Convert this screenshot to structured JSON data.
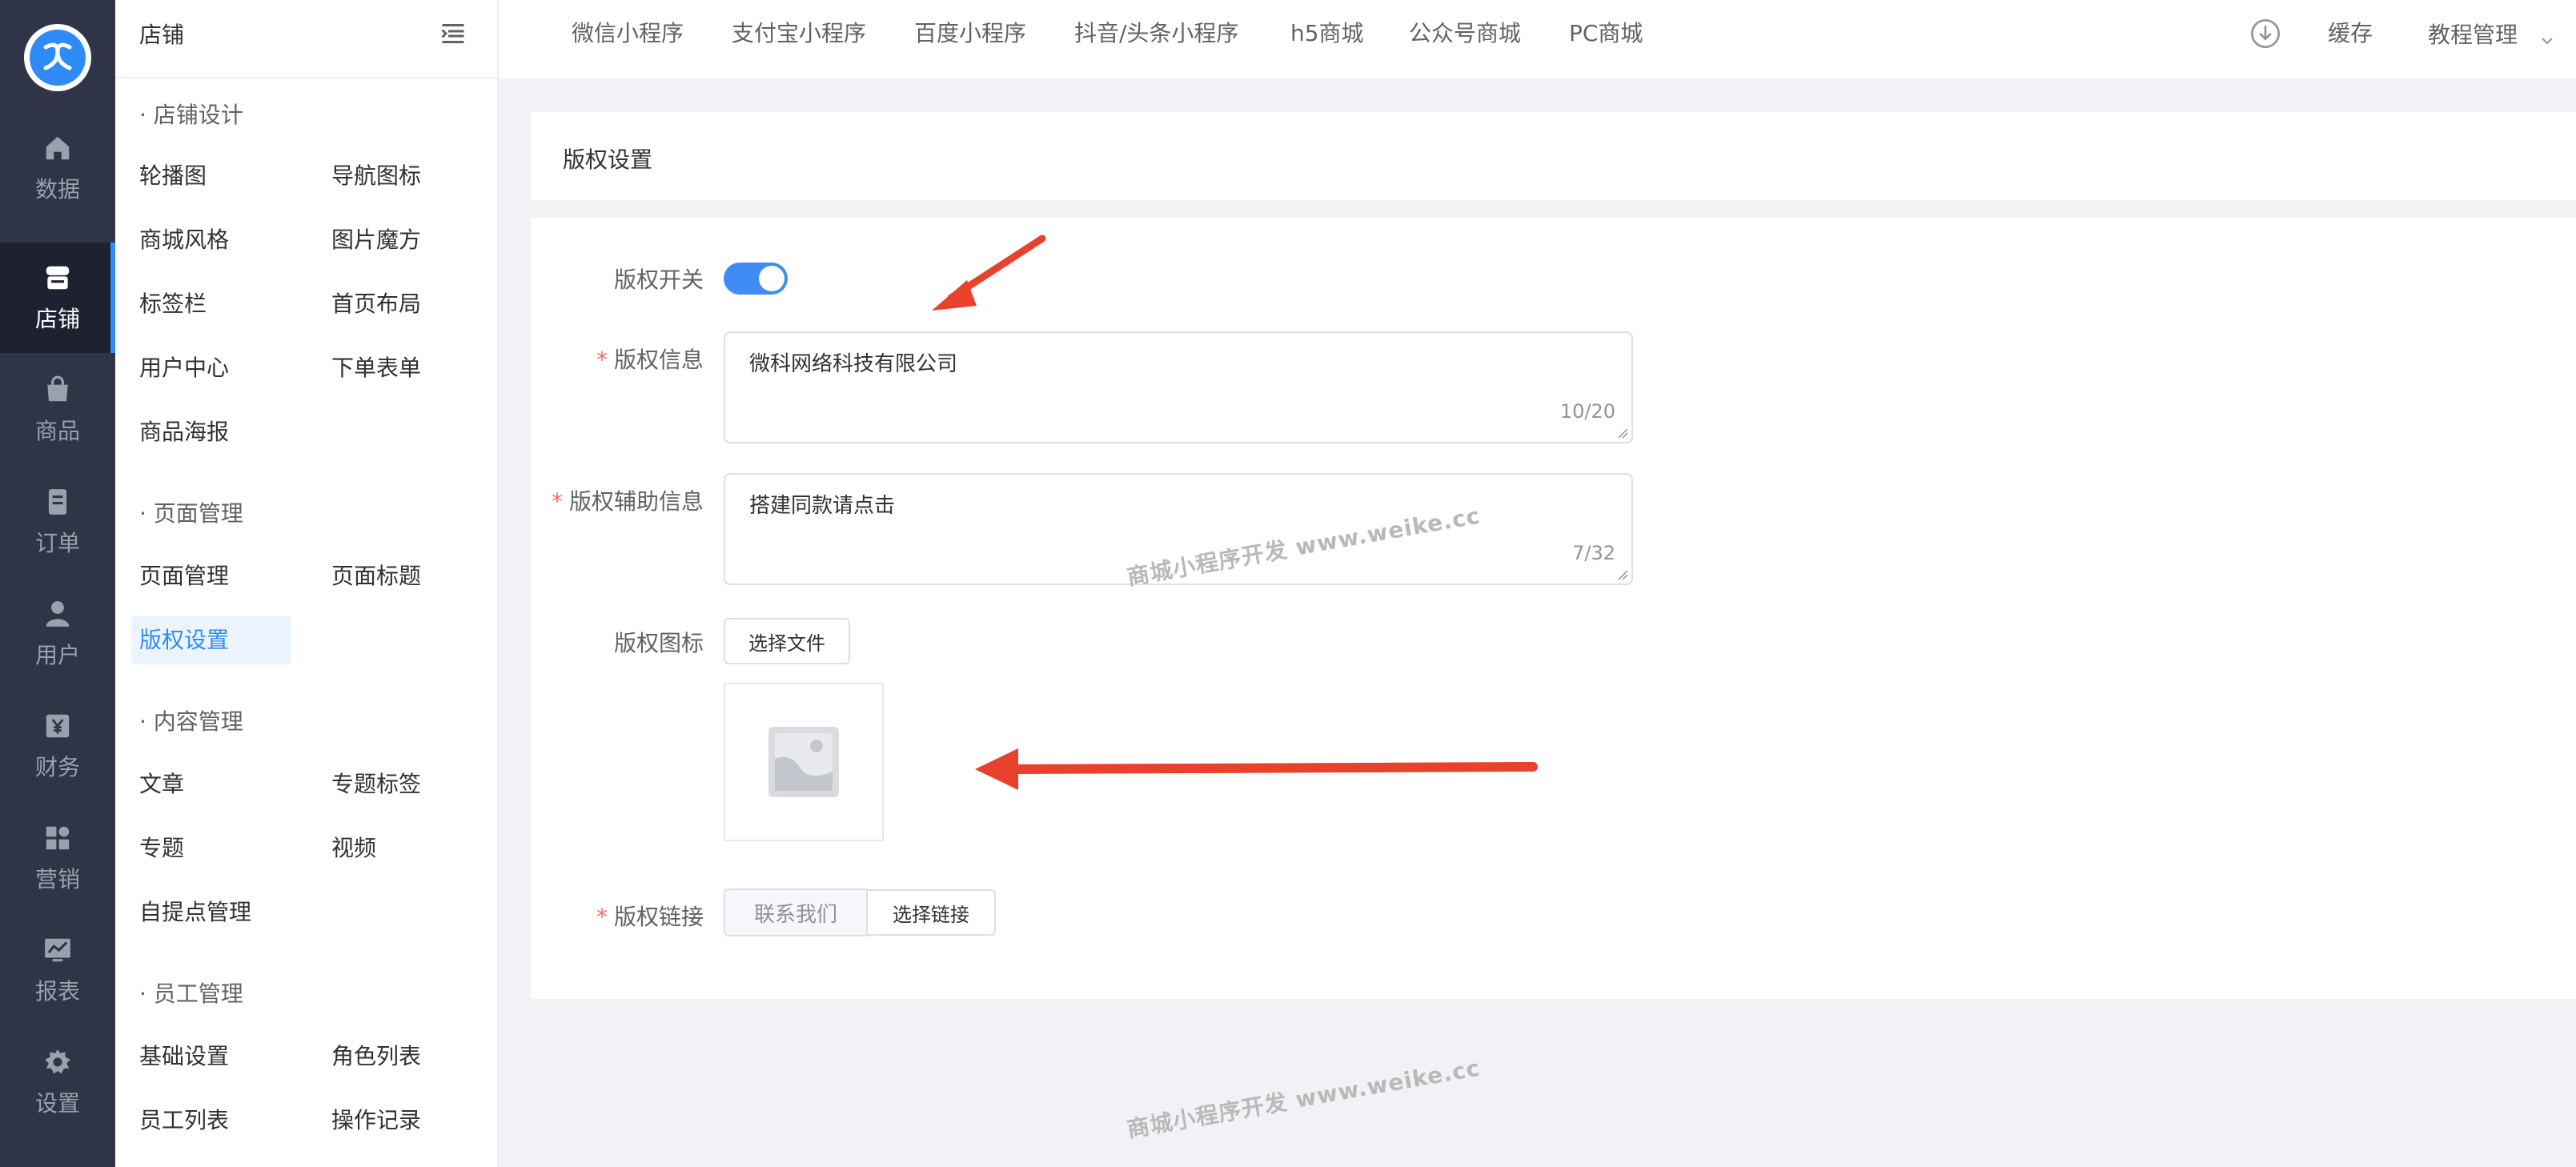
{
  "rail": {
    "items": [
      {
        "label": "数据",
        "icon": "home-icon"
      },
      {
        "label": "店铺",
        "icon": "store-icon",
        "active": true
      },
      {
        "label": "商品",
        "icon": "bag-icon"
      },
      {
        "label": "订单",
        "icon": "document-icon"
      },
      {
        "label": "用户",
        "icon": "user-icon"
      },
      {
        "label": "财务",
        "icon": "yen-icon"
      },
      {
        "label": "营销",
        "icon": "grid-icon"
      },
      {
        "label": "报表",
        "icon": "chart-icon"
      },
      {
        "label": "设置",
        "icon": "gear-icon"
      }
    ]
  },
  "subnav": {
    "title": "店铺",
    "groups": [
      {
        "title": "· 店铺设计",
        "items": [
          "轮播图",
          "导航图标",
          "商城风格",
          "图片魔方",
          "标签栏",
          "首页布局",
          "用户中心",
          "下单表单",
          "商品海报"
        ]
      },
      {
        "title": "· 页面管理",
        "items": [
          "页面管理",
          "页面标题",
          "版权设置"
        ]
      },
      {
        "title": "· 内容管理",
        "items": [
          "文章",
          "专题标签",
          "专题",
          "视频",
          "自提点管理"
        ]
      },
      {
        "title": "· 员工管理",
        "items": [
          "基础设置",
          "角色列表",
          "员工列表",
          "操作记录"
        ]
      }
    ]
  },
  "topbar": {
    "tabs": [
      "微信小程序",
      "支付宝小程序",
      "百度小程序",
      "抖音/头条小程序",
      "h5商城",
      "公众号商城",
      "PC商城"
    ],
    "cache": "缓存",
    "user": "教程管理"
  },
  "page": {
    "section_title": "版权设置"
  },
  "form": {
    "switch_label": "版权开关",
    "switch_on": true,
    "info_label": "版权信息",
    "info_value": "微科网络科技有限公司",
    "info_count": "10/20",
    "aux_label": "版权辅助信息",
    "aux_value": "搭建同款请点击",
    "aux_count": "7/32",
    "icon_label": "版权图标",
    "choose_file": "选择文件",
    "link_label": "版权链接",
    "link_value": "联系我们",
    "choose_link": "选择链接"
  },
  "watermark": "商城小程序开发 www.weike.cc",
  "colors": {
    "accent": "#2f8cf7",
    "rail_bg": "#2f3447",
    "arrow": "#e8412c",
    "required": "#f56c6c"
  }
}
